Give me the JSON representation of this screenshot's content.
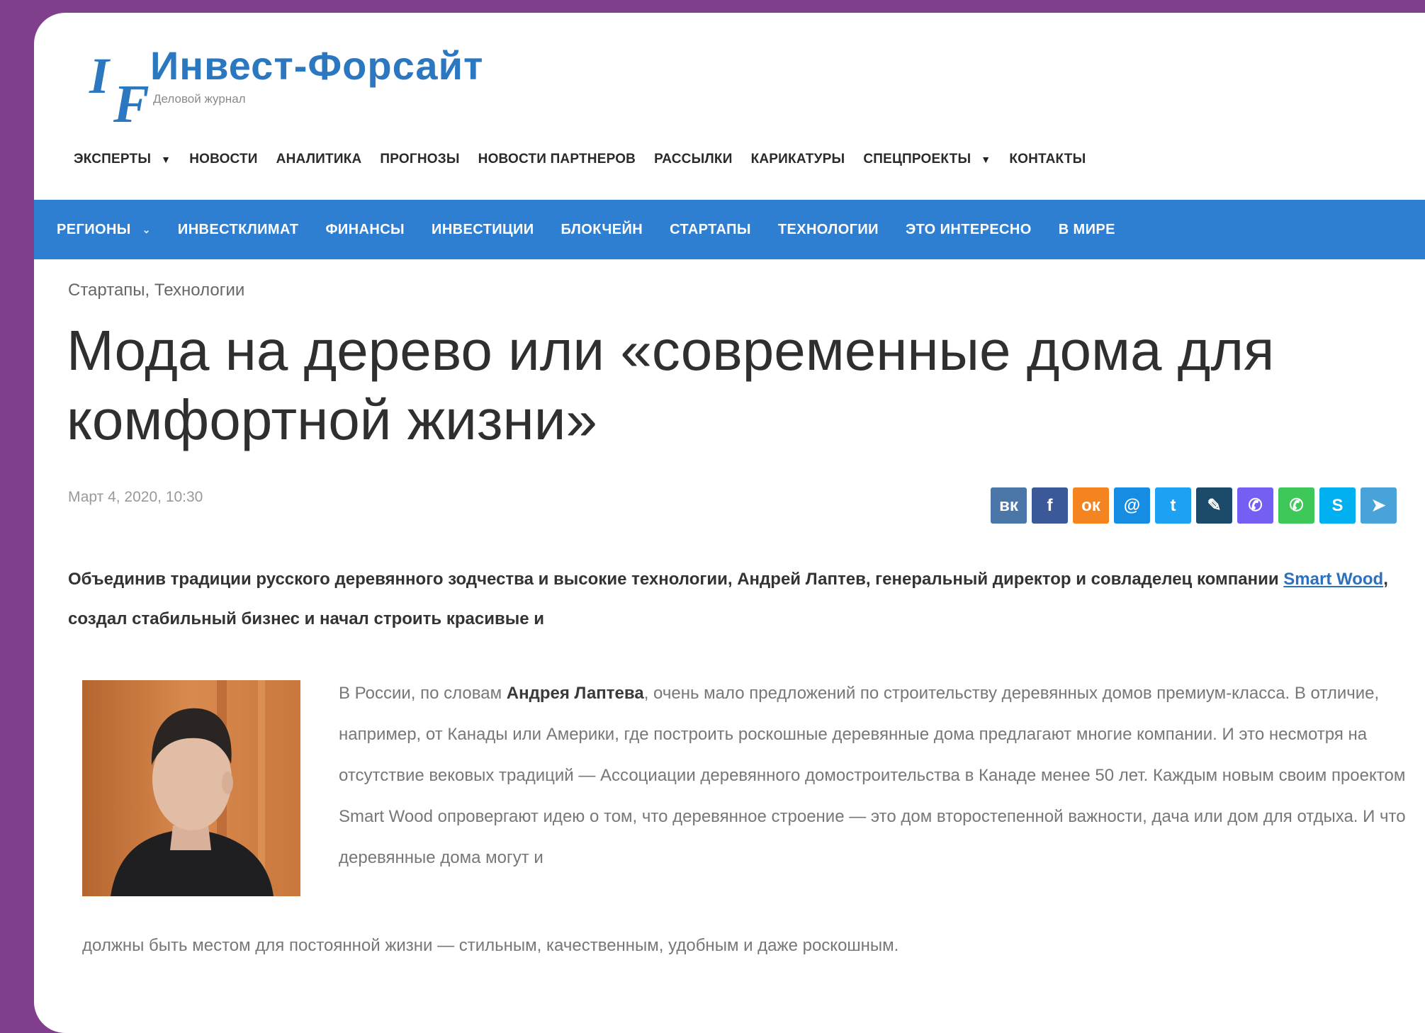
{
  "logo": {
    "mark_i": "I",
    "mark_f": "F",
    "title": "Инвест-Форсайт",
    "subtitle": "Деловой журнал"
  },
  "top_nav": [
    {
      "label": "ЭКСПЕРТЫ",
      "dropdown": true
    },
    {
      "label": "НОВОСТИ",
      "dropdown": false
    },
    {
      "label": "АНАЛИТИКА",
      "dropdown": false
    },
    {
      "label": "ПРОГНОЗЫ",
      "dropdown": false
    },
    {
      "label": "НОВОСТИ ПАРТНЕРОВ",
      "dropdown": false
    },
    {
      "label": "РАССЫЛКИ",
      "dropdown": false
    },
    {
      "label": "КАРИКАТУРЫ",
      "dropdown": false
    },
    {
      "label": "СПЕЦПРОЕКТЫ",
      "dropdown": true
    },
    {
      "label": "КОНТАКТЫ",
      "dropdown": false
    }
  ],
  "category_nav": [
    {
      "label": "РЕГИОНЫ",
      "dropdown": true
    },
    {
      "label": "ИНВЕСТКЛИМАТ",
      "dropdown": false
    },
    {
      "label": "ФИНАНСЫ",
      "dropdown": false
    },
    {
      "label": "ИНВЕСТИЦИИ",
      "dropdown": false
    },
    {
      "label": "БЛОКЧЕЙН",
      "dropdown": false
    },
    {
      "label": "СТАРТАПЫ",
      "dropdown": false
    },
    {
      "label": "ТЕХНОЛОГИИ",
      "dropdown": false
    },
    {
      "label": "ЭТО ИНТЕРЕСНО",
      "dropdown": false
    },
    {
      "label": "В МИРЕ",
      "dropdown": false
    }
  ],
  "article": {
    "breadcrumbs": "Стартапы, Технологии",
    "title": "Мода на дерево или «современные дома для комфортной жизни»",
    "date": "Март 4, 2020, 10:30",
    "lead_before": "Объединив традиции русского деревянного зодчества и высокие технологии, Андрей Лаптев, генеральный директор и совладелец компании ",
    "lead_link": "Smart Wood",
    "lead_after": ", создал стабильный бизнес и начал строить красивые и",
    "body_start": "В России, по словам ",
    "body_name": "Андрея Лаптева",
    "body_rest": ", очень мало предложений по строительству деревянных домов премиум-класса. В отличие, например, от Канады или Америки, где построить роскошные деревянные дома предлагают многие компании. И это несмотря на отсутствие вековых традиций — Ассоциации деревянного домостроительства в Канаде менее 50 лет. Каждым новым своим проектом Smart Wood опровергают идею о том, что деревянное строение — это дом второстепенной важности, дача или дом для отдыха. И что деревянные дома могут и",
    "body_last": "должны быть местом для постоянной жизни — стильным, качественным, удобным и даже роскошным."
  },
  "share_buttons": [
    {
      "name": "vk-icon",
      "glyph": "вк",
      "color": "#4a76a8"
    },
    {
      "name": "facebook-icon",
      "glyph": "f",
      "color": "#3b5998"
    },
    {
      "name": "odnoklassniki-icon",
      "glyph": "ок",
      "color": "#f48420"
    },
    {
      "name": "mail-icon",
      "glyph": "@",
      "color": "#168de2"
    },
    {
      "name": "twitter-icon",
      "glyph": "t",
      "color": "#1da1f2"
    },
    {
      "name": "livejournal-icon",
      "glyph": "✎",
      "color": "#1b4a6b"
    },
    {
      "name": "viber-icon",
      "glyph": "✆",
      "color": "#7360f2"
    },
    {
      "name": "whatsapp-icon",
      "glyph": "✆",
      "color": "#3ec85a"
    },
    {
      "name": "skype-icon",
      "glyph": "S",
      "color": "#00aff0"
    },
    {
      "name": "telegram-icon",
      "glyph": "➤",
      "color": "#4aa3d8"
    }
  ]
}
